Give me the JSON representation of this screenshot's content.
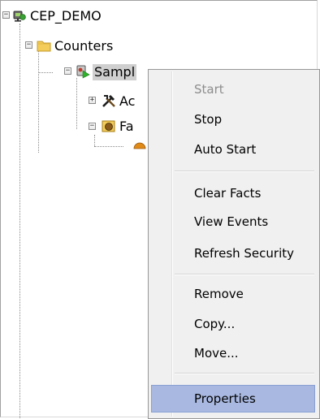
{
  "tree": {
    "root_label": "CEP_DEMO",
    "counters_label": "Counters",
    "sample_label": "Sampl",
    "actions_label": "Ac",
    "facts_label": "Fa"
  },
  "context_menu": {
    "start": "Start",
    "stop": "Stop",
    "auto_start": "Auto Start",
    "clear_facts": "Clear Facts",
    "view_events": "View Events",
    "refresh_security": "Refresh Security",
    "remove": "Remove",
    "copy": "Copy...",
    "move": "Move...",
    "properties": "Properties"
  },
  "colors": {
    "menu_highlight": "#a8b8e0",
    "disabled_text": "#8d8d8d",
    "selection": "#cfcfcf"
  }
}
